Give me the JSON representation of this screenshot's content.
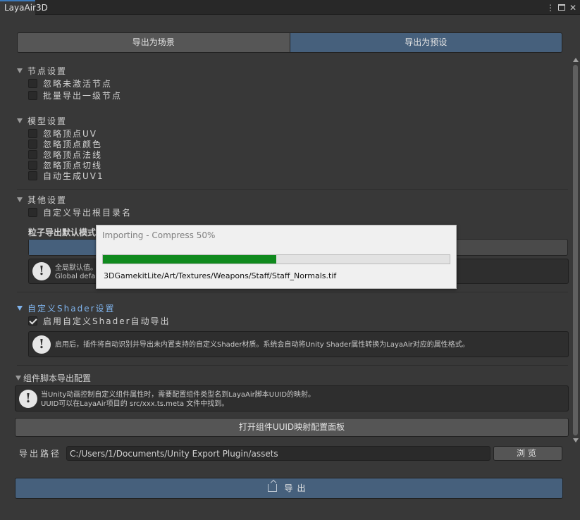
{
  "window": {
    "tab_title": "LayaAir3D",
    "menu_glyph": "⋮",
    "close_glyph": "✕"
  },
  "mode": {
    "scene_label": "导出为场景",
    "prefab_label": "导出为预设",
    "selected": "导出为预设"
  },
  "node_settings": {
    "title": "节点设置",
    "options": [
      {
        "label": "忽略未激活节点",
        "checked": false
      },
      {
        "label": "批量导出一级节点",
        "checked": false
      }
    ]
  },
  "model_settings": {
    "title": "模型设置",
    "options": [
      {
        "label": "忽略顶点UV",
        "checked": false
      },
      {
        "label": "忽略顶点颜色",
        "checked": false
      },
      {
        "label": "忽略顶点法线",
        "checked": false
      },
      {
        "label": "忽略顶点切线",
        "checked": false
      },
      {
        "label": "自动生成UV1",
        "checked": false
      }
    ]
  },
  "other_settings": {
    "title": "其他设置",
    "options": [
      {
        "label": "自定义导出根目录名",
        "checked": false
      }
    ],
    "particle_label": "粒子导出默认模式",
    "particle_help_line1": "全局默认值。",
    "particle_help_line2": "Global defau"
  },
  "shader_settings": {
    "title": "自定义Shader设置",
    "option_label": "启用自定义Shader自动导出",
    "option_checked": true,
    "help": "启用后，插件将自动识别并导出未内置支持的自定义Shader材质。系统会自动将Unity Shader属性转换为LayaAir对应的属性格式。"
  },
  "component_script": {
    "title": "组件脚本导出配置",
    "help_line1": "当Unity动画控制自定义组件属性时，需要配置组件类型名到LayaAir脚本UUID的映射。",
    "help_line2": "UUID可以在LayaAir项目的 src/xxx.ts.meta 文件中找到。",
    "button_label": "打开组件UUID映射配置面板"
  },
  "export_path": {
    "label": "导出路径",
    "value": "C:/Users/1/Documents/Unity Export Plugin/assets",
    "browse_label": "浏览"
  },
  "export_button_label": "导出",
  "help_icon_glyph": "!",
  "progress_dialog": {
    "title": "Importing - Compress 50%",
    "progress": 0.5,
    "file": "3DGamekitLite/Art/Textures/Weapons/Staff/Staff_Normals.tif"
  }
}
